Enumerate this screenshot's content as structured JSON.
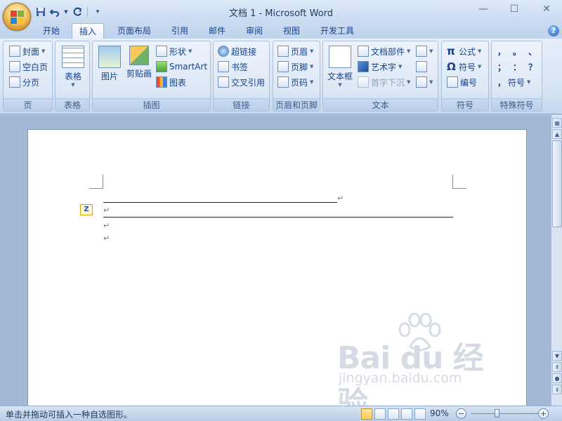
{
  "window": {
    "title": "文档 1 - Microsoft Word",
    "minimize": "—",
    "maximize": "☐",
    "close": "✕"
  },
  "quick_access": {
    "save_icon": "save-icon",
    "undo_icon": "undo-icon",
    "redo_icon": "redo-icon",
    "customize_icon": "customize-qat-icon"
  },
  "tabs": [
    {
      "label": "开始"
    },
    {
      "label": "插入",
      "active": true
    },
    {
      "label": "页面布局"
    },
    {
      "label": "引用"
    },
    {
      "label": "邮件"
    },
    {
      "label": "审阅"
    },
    {
      "label": "视图"
    },
    {
      "label": "开发工具"
    }
  ],
  "help": "?",
  "ribbon": {
    "groups": {
      "pages": {
        "label": "页",
        "cover": "封面",
        "blank": "空白页",
        "break": "分页"
      },
      "tables": {
        "label": "表格",
        "table": "表格"
      },
      "illustrations": {
        "label": "插图",
        "picture": "图片",
        "clipart": "剪贴画",
        "shapes": "形状",
        "smartart": "SmartArt",
        "chart": "图表"
      },
      "links": {
        "label": "链接",
        "hyperlink": "超链接",
        "bookmark": "书签",
        "crossref": "交叉引用"
      },
      "header_footer": {
        "label": "页眉和页脚",
        "header": "页眉",
        "footer": "页脚",
        "page_number": "页码"
      },
      "text": {
        "label": "文本",
        "textbox": "文本框",
        "quickparts": "文档部件",
        "wordart": "艺术字",
        "dropcap": "首字下沉"
      },
      "symbols": {
        "label": "符号",
        "equation": "公式",
        "symbol": "符号",
        "numbering": "编号"
      },
      "special": {
        "label": "特殊符号",
        "comma": "，",
        "period": "。",
        "pause": "、",
        "semicolon": "；",
        "colon": "：",
        "question": "？",
        "symbol": "符号",
        "symbol_prefix": "，"
      }
    }
  },
  "document": {
    "paragraph_mark": "↵"
  },
  "watermark": {
    "brand": "Bai du 经验",
    "url": "jingyan.baidu.com"
  },
  "status": {
    "text": "单击并拖动可插入一种自选图形。",
    "zoom": "90%",
    "zoom_level_percent": 90,
    "zoom_out": "−",
    "zoom_in": "+"
  }
}
